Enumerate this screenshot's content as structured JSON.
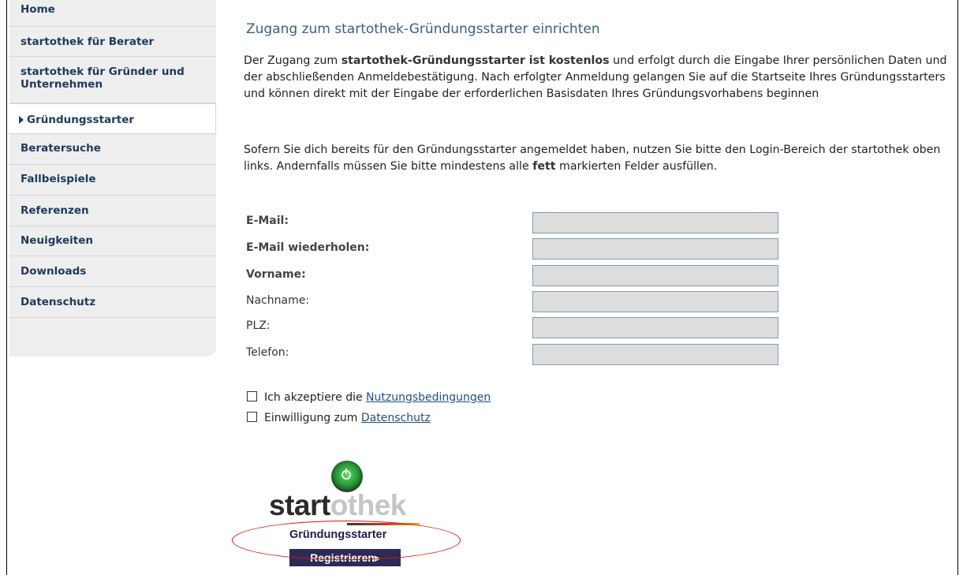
{
  "sidebar": {
    "items": [
      {
        "label": "Home"
      },
      {
        "label": "startothek für Berater"
      },
      {
        "label": "startothek für Gründer und Unternehmen"
      },
      {
        "label": "Gründungsstarter"
      },
      {
        "label": "Beratersuche"
      },
      {
        "label": "Fallbeispiele"
      },
      {
        "label": "Referenzen"
      },
      {
        "label": "Neuigkeiten"
      },
      {
        "label": "Downloads"
      },
      {
        "label": "Datenschutz"
      }
    ],
    "active_item": "Gründungsstarter"
  },
  "main": {
    "title": "Zugang zum startothek-Gründungsstarter einrichten",
    "intro": {
      "part1": "Der Zugang zum ",
      "bold": "startothek-Gründungsstarter ist kostenlos",
      "part2": " und erfolgt durch die Eingabe Ihrer persönlichen Daten und der abschließenden Anmeldebestätigung. Nach erfolgter Anmeldung gelangen Sie auf die Startseite Ihres Gründungsstarters und können direkt mit der Eingabe der erforderlichen Basisdaten Ihres Gründungsvorhabens beginnen"
    },
    "note": {
      "part1": "Sofern Sie dich bereits für den Gründungsstarter angemeldet haben, nutzen Sie bitte den Login-Bereich der startothek oben links. Andernfalls müssen Sie bitte mindestens alle ",
      "bold": "fett",
      "part2": " markierten Felder ausfüllen."
    },
    "form": {
      "fields": [
        {
          "label": "E-Mail:",
          "value": "",
          "required": true
        },
        {
          "label": "E-Mail wiederholen:",
          "value": "",
          "required": true
        },
        {
          "label": "Vorname:",
          "value": "",
          "required": true
        },
        {
          "label": "Nachname:",
          "value": "",
          "required": false
        },
        {
          "label": "PLZ:",
          "value": "",
          "required": false
        },
        {
          "label": "Telefon:",
          "value": "",
          "required": false
        }
      ],
      "checkboxes": [
        {
          "text": "Ich akzeptiere die ",
          "link": "Nutzungsbedingungen",
          "checked": false
        },
        {
          "text": "Einwilligung zum ",
          "link": "Datenschutz",
          "checked": false
        }
      ]
    },
    "logo": {
      "part1": "start",
      "part2": "othek",
      "subtitle": "Gründungsstarter",
      "icon": "power-button-icon"
    },
    "register_label": "Registrieren▸"
  },
  "colors": {
    "sidebar_bg": "#eeeeee",
    "nav_text": "#1e3a5c",
    "title": "#3b5f85",
    "input_bg": "#dddddd",
    "input_border": "#7f9db9",
    "link": "#1f4e8c",
    "register_bg": "#2b2b55",
    "annotation": "#dd1111"
  }
}
